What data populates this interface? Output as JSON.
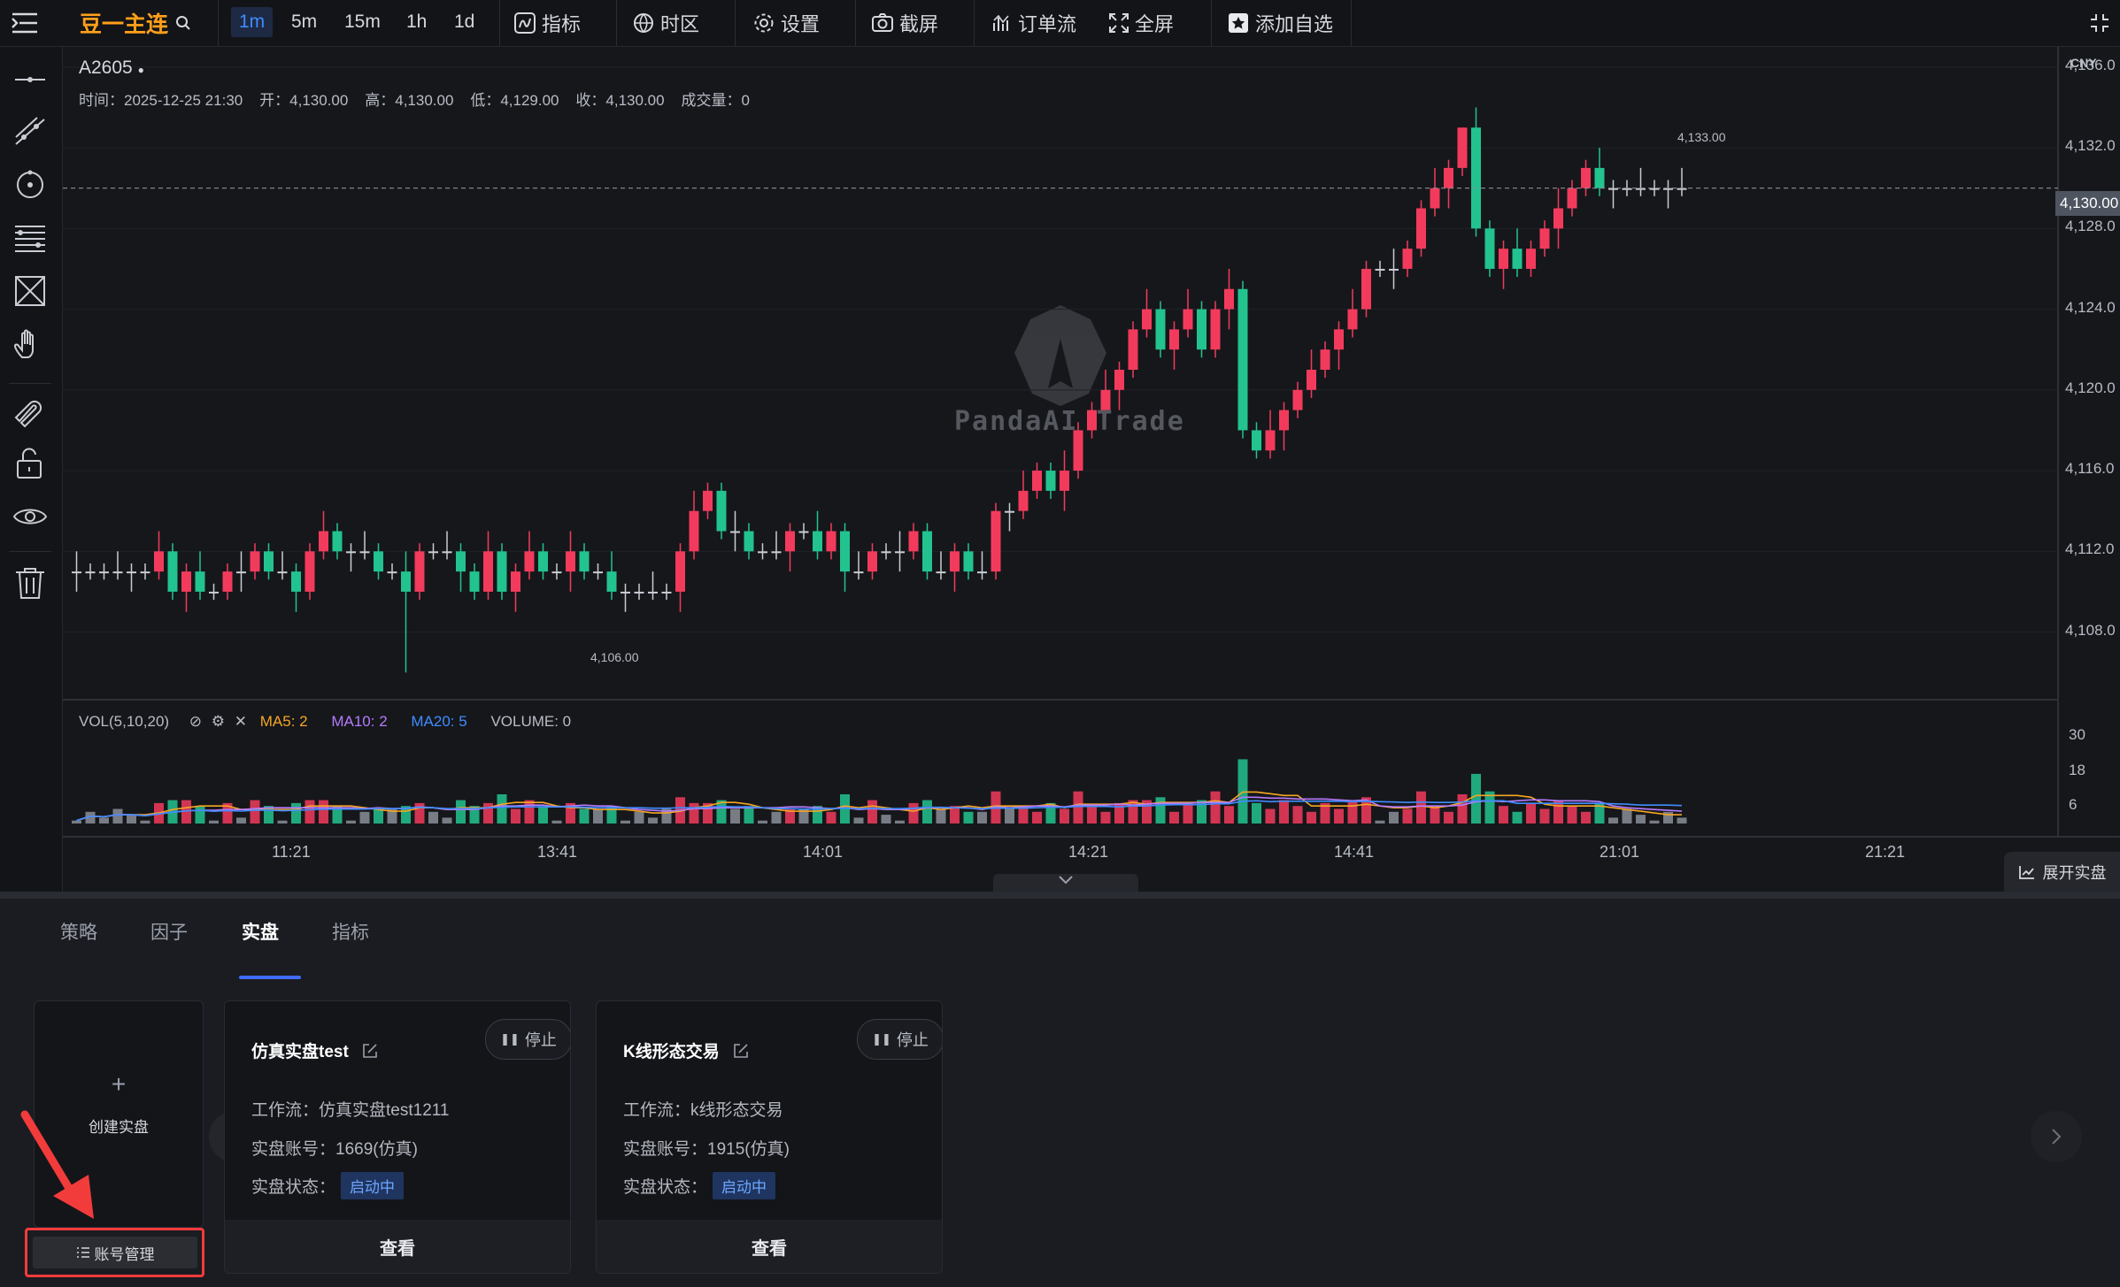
{
  "toolbar": {
    "symbol": "豆一主连",
    "timeframes": [
      "1m",
      "5m",
      "15m",
      "1h",
      "1d"
    ],
    "active_timeframe": "1m",
    "indicators": "指标",
    "timezone": "时区",
    "settings": "设置",
    "screenshot": "截屏",
    "orderflow": "订单流",
    "fullscreen": "全屏",
    "add_watchlist": "添加自选"
  },
  "chart": {
    "instrument": "A2605",
    "currency": "CNY",
    "ohlc": {
      "time": "时间：2025-12-25 21:30",
      "open": "开：4,130.00",
      "high": "高：4,130.00",
      "low": "低：4,129.00",
      "close": "收：4,130.00",
      "volume": "成交量：0"
    },
    "watermark": "PandaAI Trade",
    "current_price": "4,130.00",
    "high_label": "4,133.00",
    "low_label": "4,106.00",
    "vol_legend": {
      "name": "VOL(5,10,20)",
      "ma5": "MA5: 2",
      "ma10": "MA10: 2",
      "ma20": "MA20: 5",
      "volume": "VOLUME: 0"
    },
    "expand_label": "展开实盘",
    "colors": {
      "up": "#f23b5c",
      "down": "#22c38e",
      "ma5": "#f5a623",
      "ma10": "#b57bff",
      "ma20": "#3f8cff"
    }
  },
  "chart_data": {
    "type": "candlestick",
    "price_axis": [
      "4,136.0",
      "4,132.0",
      "4,128.0",
      "4,124.0",
      "4,120.0",
      "4,116.0",
      "4,112.0",
      "4,108.0"
    ],
    "ylim": [
      4105,
      4137
    ],
    "time_axis": [
      "11:21",
      "13:41",
      "14:01",
      "14:21",
      "14:41",
      "21:01",
      "21:21"
    ],
    "volume_axis": [
      "30",
      "18",
      "6"
    ],
    "close_values": [
      4111,
      4111,
      4111,
      4111,
      4111,
      4111,
      4112,
      4110,
      4111,
      4110,
      4110,
      4111,
      4111,
      4112,
      4111,
      4111,
      4110,
      4112,
      4113,
      4112,
      4112,
      4112,
      4111,
      4111,
      4110,
      4112,
      4112,
      4112,
      4111,
      4110,
      4112,
      4110,
      4111,
      4112,
      4111,
      4111,
      4112,
      4111,
      4111,
      4110,
      4110,
      4110,
      4110,
      4110,
      4112,
      4114,
      4115,
      4113,
      4113,
      4112,
      4112,
      4112,
      4113,
      4113,
      4112,
      4113,
      4111,
      4111,
      4112,
      4112,
      4112,
      4113,
      4111,
      4111,
      4112,
      4111,
      4111,
      4114,
      4114,
      4115,
      4116,
      4115,
      4116,
      4118,
      4119,
      4120,
      4121,
      4123,
      4124,
      4122,
      4123,
      4124,
      4122,
      4124,
      4125,
      4118,
      4117,
      4118,
      4119,
      4120,
      4121,
      4122,
      4123,
      4124,
      4126,
      4126,
      4126,
      4127,
      4129,
      4130,
      4131,
      4133,
      4128,
      4126,
      4127,
      4126,
      4127,
      4128,
      4129,
      4130,
      4131,
      4130,
      4130,
      4130,
      4130,
      4130,
      4130,
      4130
    ]
  },
  "panel": {
    "tabs": [
      "策略",
      "因子",
      "实盘",
      "指标"
    ],
    "active_tab": "实盘",
    "create_label": "创建实盘",
    "create_plus": "+",
    "account_mgmt": "账号管理",
    "cards": [
      {
        "title": "仿真实盘test",
        "stop": "停止",
        "workflow": "工作流：仿真实盘test1211",
        "account": "实盘账号：1669(仿真)",
        "status_label": "实盘状态：",
        "status": "启动中",
        "view": "查看"
      },
      {
        "title": "K线形态交易",
        "stop": "停止",
        "workflow": "工作流：k线形态交易",
        "account": "实盘账号：1915(仿真)",
        "status_label": "实盘状态：",
        "status": "启动中",
        "view": "查看"
      }
    ]
  }
}
